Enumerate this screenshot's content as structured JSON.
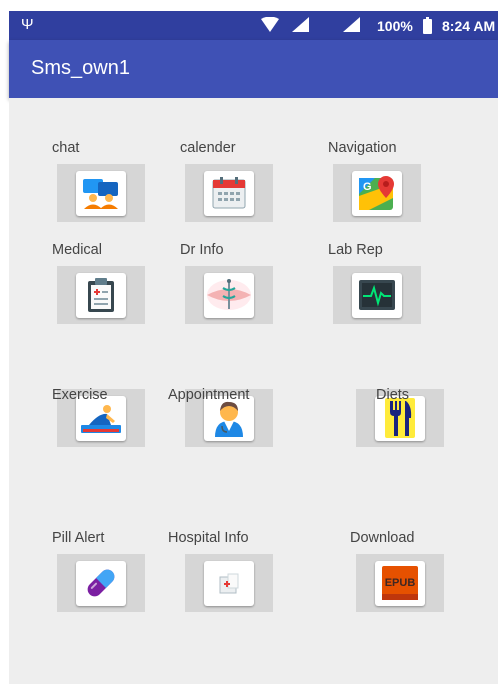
{
  "status_bar": {
    "battery": "100%",
    "time": "8:24 AM"
  },
  "app_bar": {
    "title": "Sms_own1"
  },
  "grid": {
    "chat": {
      "label": "chat",
      "icon": "chat-icon"
    },
    "calender": {
      "label": "calender",
      "icon": "calendar-icon"
    },
    "navigation": {
      "label": "Navigation",
      "icon": "maps-icon"
    },
    "medical": {
      "label": "Medical",
      "icon": "clipboard-icon"
    },
    "dr_info": {
      "label": "Dr Info",
      "icon": "caduceus-icon"
    },
    "lab_rep": {
      "label": "Lab Rep",
      "icon": "heart-monitor-icon"
    },
    "exercise": {
      "label": "Exercise",
      "icon": "exercise-icon"
    },
    "appointment": {
      "label": "Appointment",
      "icon": "doctor-icon"
    },
    "diets": {
      "label": "Diets",
      "icon": "fork-knife-icon"
    },
    "pill_alert": {
      "label": "Pill Alert",
      "icon": "pill-icon"
    },
    "hospital_info": {
      "label": "Hospital Info",
      "icon": "hospital-icon"
    },
    "download": {
      "label": "Download",
      "icon": "epub-icon",
      "icon_text": "EPUB"
    }
  },
  "colors": {
    "status_bar": "#303F9F",
    "app_bar": "#3F51B5",
    "background": "#EEEEEE",
    "tile": "#D6D6D6"
  }
}
